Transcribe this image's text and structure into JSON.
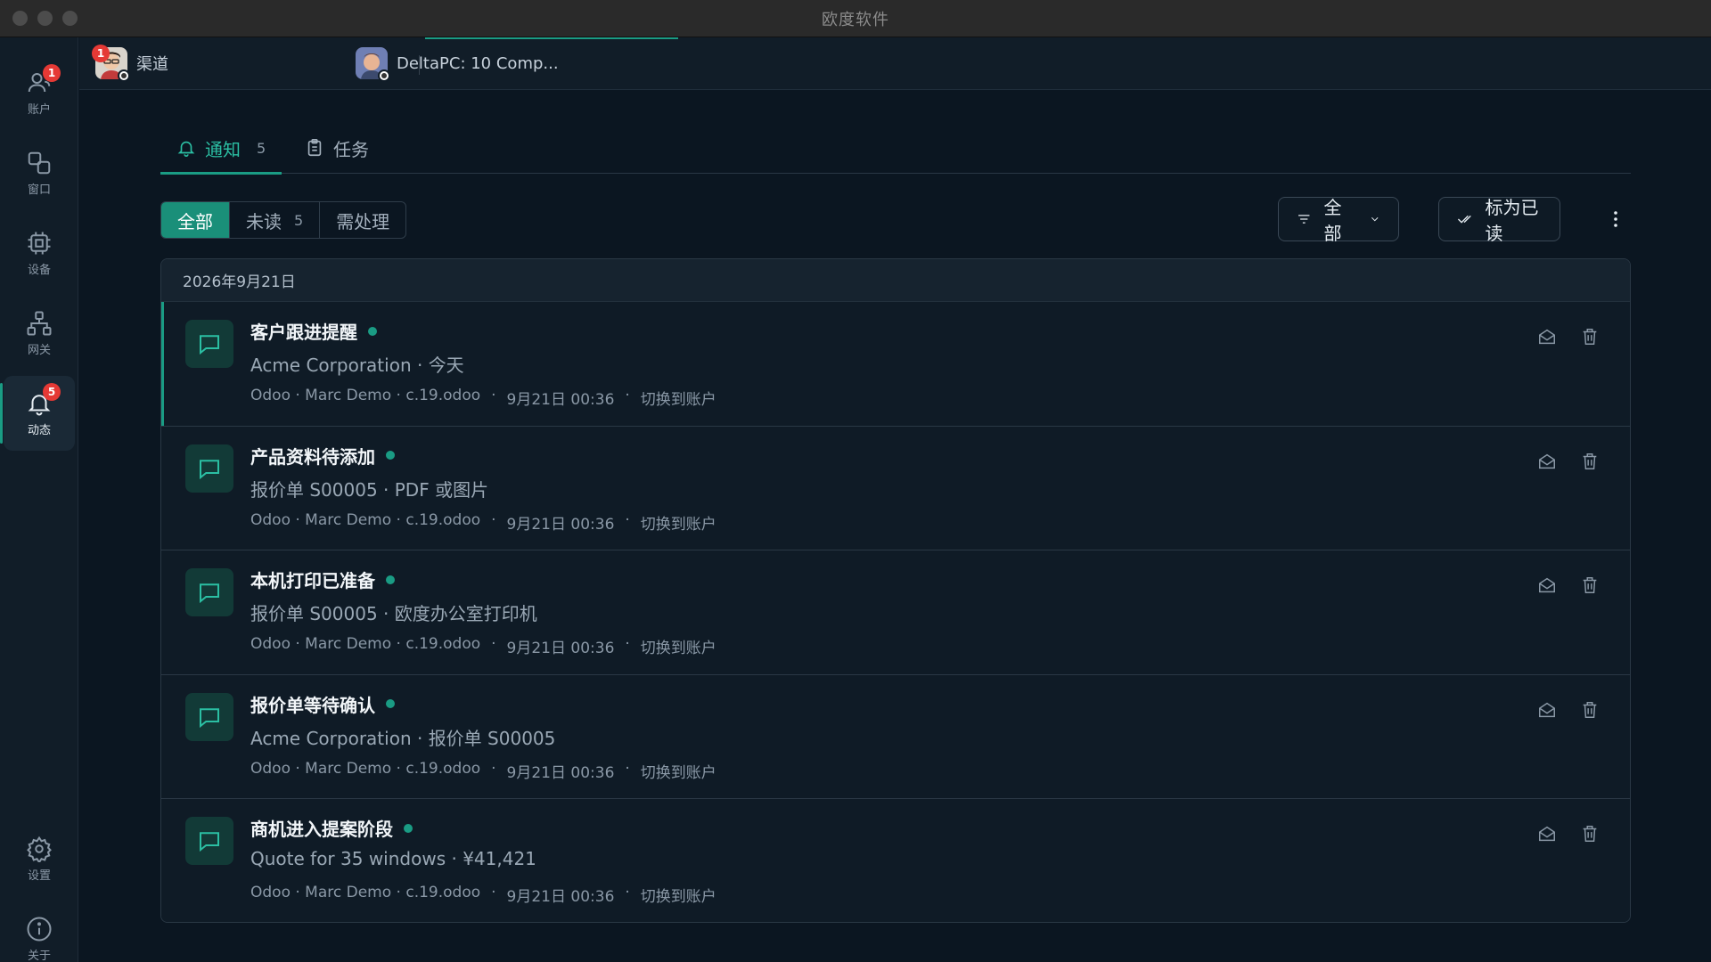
{
  "window": {
    "title": "欧度软件"
  },
  "sidebar": {
    "items": [
      {
        "label": "账户",
        "icon": "user-icon",
        "badge": "1"
      },
      {
        "label": "窗口",
        "icon": "windows-icon"
      },
      {
        "label": "设备",
        "icon": "chip-icon"
      },
      {
        "label": "网关",
        "icon": "network-icon"
      },
      {
        "label": "动态",
        "icon": "bell-icon",
        "badge": "5",
        "active": true
      },
      {
        "label": "设置",
        "icon": "gear-icon"
      },
      {
        "label": "关于",
        "icon": "info-icon"
      }
    ]
  },
  "topbar": {
    "tabs": [
      {
        "label": "渠道",
        "badge": "1"
      },
      {
        "label": "DeltaPC: 10 Comp...",
        "active": true
      }
    ]
  },
  "main": {
    "tabs": [
      {
        "label": "通知",
        "count": "5",
        "icon": "bell-icon",
        "active": true
      },
      {
        "label": "任务",
        "icon": "clipboard-icon"
      }
    ],
    "filters": [
      {
        "label": "全部",
        "active": true
      },
      {
        "label": "未读",
        "count": "5"
      },
      {
        "label": "需处理"
      }
    ],
    "type_filter": {
      "label": "全部"
    },
    "mark_read_label": "标为已读",
    "date_header": "2026年9月21日",
    "notifications": [
      {
        "title": "客户跟进提醒",
        "subtitle": "Acme Corporation · 今天",
        "source": "Odoo · Marc Demo · c.19.odoo",
        "time": "9月21日 00:36",
        "action": "切换到账户"
      },
      {
        "title": "产品资料待添加",
        "subtitle": "报价单 S00005 · PDF 或图片",
        "source": "Odoo · Marc Demo · c.19.odoo",
        "time": "9月21日 00:36",
        "action": "切换到账户"
      },
      {
        "title": "本机打印已准备",
        "subtitle": "报价单 S00005 · 欧度办公室打印机",
        "source": "Odoo · Marc Demo · c.19.odoo",
        "time": "9月21日 00:36",
        "action": "切换到账户"
      },
      {
        "title": "报价单等待确认",
        "subtitle": "Acme Corporation · 报价单 S00005",
        "source": "Odoo · Marc Demo · c.19.odoo",
        "time": "9月21日 00:36",
        "action": "切换到账户"
      },
      {
        "title": "商机进入提案阶段",
        "subtitle": "Quote for 35 windows · ¥41,421",
        "source": "Odoo · Marc Demo · c.19.odoo",
        "time": "9月21日 00:36",
        "action": "切换到账户"
      }
    ]
  },
  "colors": {
    "accent": "#1a9c84",
    "badge": "#e53935",
    "background": "#0b1621"
  }
}
